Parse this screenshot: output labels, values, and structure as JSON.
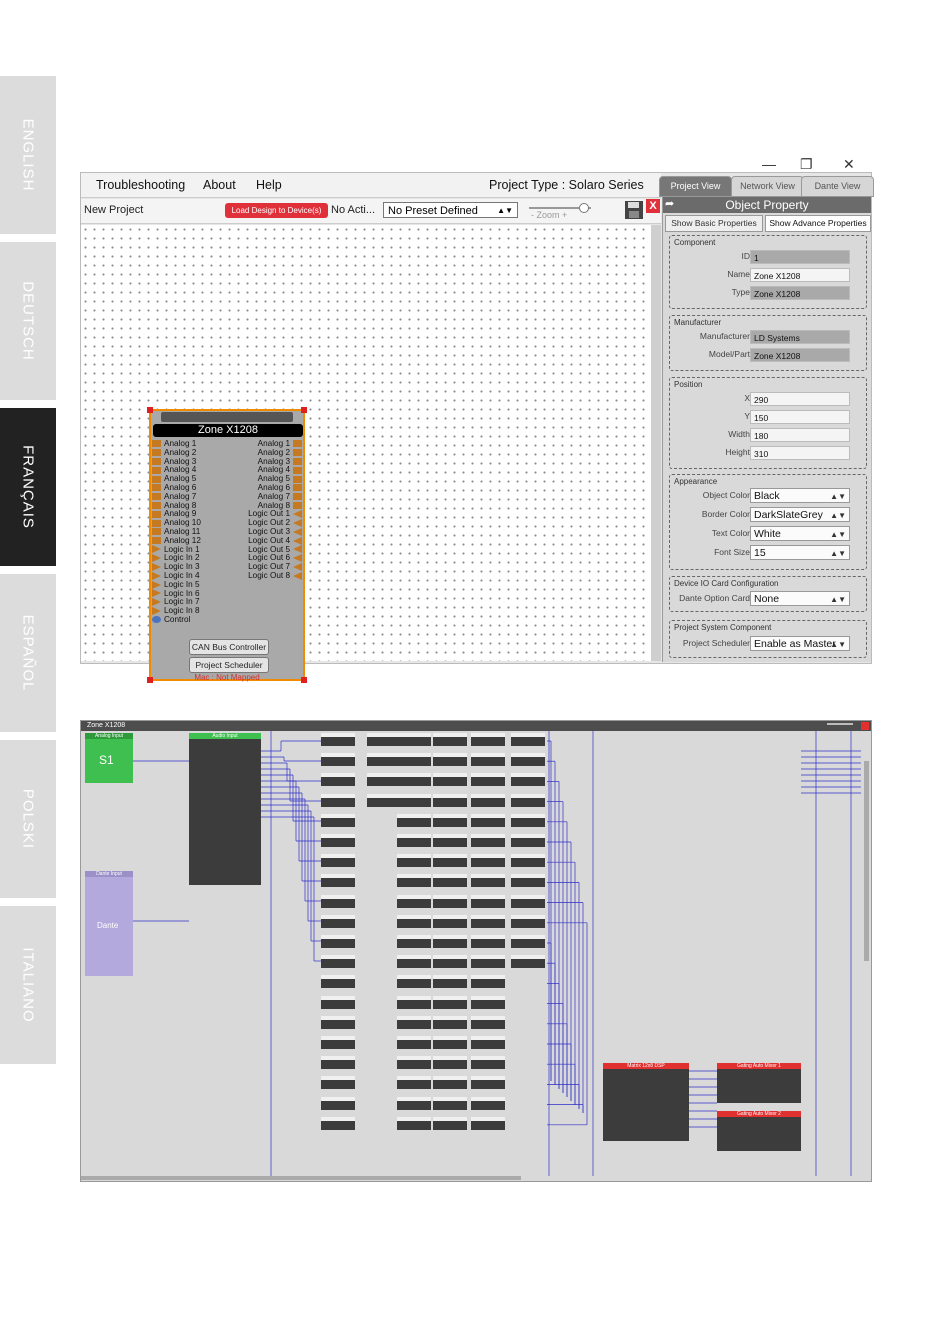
{
  "languages": [
    {
      "label": "ENGLISH",
      "active": false
    },
    {
      "label": "DEUTSCH",
      "active": false
    },
    {
      "label": "FRANÇAIS",
      "active": true
    },
    {
      "label": "ESPAÑOL",
      "active": false
    },
    {
      "label": "POLSKI",
      "active": false
    },
    {
      "label": "ITALIANO",
      "active": false
    }
  ],
  "window": {
    "minimize": "—",
    "maximize": "❐",
    "close": "✕"
  },
  "menu": {
    "troubleshooting": "Troubleshooting",
    "about": "About",
    "help": "Help",
    "project_type": "Project Type : Solaro Series"
  },
  "views": {
    "project": "Project View",
    "network": "Network View",
    "dante": "Dante View"
  },
  "toolbar": {
    "project_name": "New Project",
    "load_button": "Load Design to Device(s)",
    "no_action": "No Acti...",
    "preset": "No Preset Defined",
    "zoom_label": "- Zoom +",
    "zoom_level": 0.9
  },
  "object_property": {
    "title": "Object Property",
    "show_basic": "Show Basic Properties",
    "show_advance": "Show Advance Properties",
    "component": {
      "title": "Component",
      "id_label": "ID",
      "id": "1",
      "name_label": "Name",
      "name": "Zone X1208",
      "type_label": "Type",
      "type": "Zone X1208"
    },
    "manufacturer": {
      "title": "Manufacturer",
      "manufacturer_label": "Manufacturer",
      "manufacturer": "LD Systems",
      "model_label": "Model/Part",
      "model": "Zone X1208"
    },
    "position": {
      "title": "Position",
      "x_label": "X",
      "x": "290",
      "y_label": "Y",
      "y": "150",
      "width_label": "Width",
      "width": "180",
      "height_label": "Height",
      "height": "310"
    },
    "appearance": {
      "title": "Appearance",
      "object_color_label": "Object Color",
      "object_color": "Black",
      "border_color_label": "Border Color",
      "border_color": "DarkSlateGrey",
      "text_color_label": "Text Color",
      "text_color": "White",
      "font_size_label": "Font Size",
      "font_size": "15"
    },
    "io_card": {
      "title": "Device IO Card Configuration",
      "dante_label": "Dante Option Card",
      "dante": "None"
    },
    "project_system": {
      "title": "Project System Component",
      "scheduler_label": "Project Scheduler",
      "scheduler": "Enable as Master"
    }
  },
  "device": {
    "name": "Zone X1208",
    "inputs": [
      "Analog 1",
      "Analog 2",
      "Analog 3",
      "Analog 4",
      "Analog 5",
      "Analog 6",
      "Analog 7",
      "Analog 8",
      "Analog 9",
      "Analog 10",
      "Analog 11",
      "Analog 12",
      "Logic In 1",
      "Logic In 2",
      "Logic In 3",
      "Logic In 4",
      "Logic In 5",
      "Logic In 6",
      "Logic In 7",
      "Logic In 8",
      "Control"
    ],
    "outputs": [
      "Analog 1",
      "Analog 2",
      "Analog 3",
      "Analog 4",
      "Analog 5",
      "Analog 6",
      "Analog 7",
      "Analog 8",
      "Logic Out 1",
      "Logic Out 2",
      "Logic Out 3",
      "Logic Out 4",
      "Logic Out 5",
      "Logic Out 6",
      "Logic Out 7",
      "Logic Out 8"
    ],
    "can_bus": "CAN Bus Controller",
    "scheduler": "Project Scheduler",
    "mac": "Mac : Not Mapped"
  },
  "dsp_view": {
    "title": "Zone X1208",
    "analog_input": "Analog Input",
    "s1": "S1",
    "dante_input": "Dante Input",
    "dante": "Dante",
    "audio_input": "Audio Input",
    "matrix": "Matrix 12x8 DSP",
    "mixer1": "Gating Auto Mixer 1",
    "mixer2": "Gating Auto Mixer 2",
    "columns": [
      "HPF Ch.",
      "AFS Ch.",
      "PRE-PEQ Ch.",
      "Noise Gate Ch.",
      "Compressor Ch.",
      "POST PEQ Ch."
    ],
    "colors": {
      "analog": "#3fbf4f",
      "dante": "#b4a9dc",
      "block": "#3c3c3c",
      "header": "#e03030",
      "wire": "#2e2ec8"
    }
  }
}
